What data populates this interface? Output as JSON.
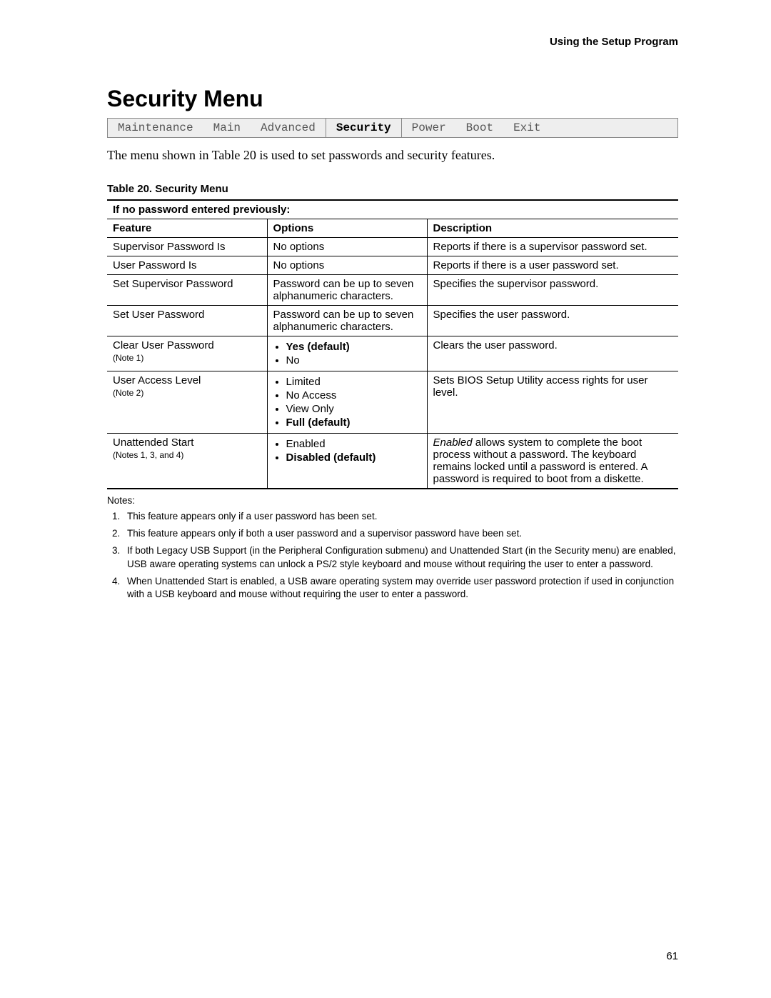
{
  "running_head": "Using the Setup Program",
  "section_title": "Security Menu",
  "bios_tabs": {
    "items": [
      "Maintenance",
      "Main",
      "Advanced",
      "Security",
      "Power",
      "Boot",
      "Exit"
    ],
    "active_index": 3
  },
  "intro_text": "The menu shown in Table 20 is used to set passwords and security features.",
  "table_caption": "Table 20.    Security Menu",
  "sub_header": "If no password entered previously:",
  "col_headers": {
    "feature": "Feature",
    "options": "Options",
    "description": "Description"
  },
  "rows": [
    {
      "feature": "Supervisor Password Is",
      "options_text": "No options",
      "description": "Reports if there is a supervisor password set."
    },
    {
      "feature": "User Password Is",
      "options_text": "No options",
      "description": "Reports if there is a user password set."
    },
    {
      "feature": "Set Supervisor Password",
      "options_text": "Password can be up to seven alphanumeric characters.",
      "description": "Specifies the supervisor password."
    },
    {
      "feature": "Set User Password",
      "options_text": "Password can be up to seven alphanumeric characters.",
      "description": "Specifies the user password."
    },
    {
      "feature": "Clear User Password",
      "feature_note": "(Note 1)",
      "options_list": [
        {
          "label": "Yes (default)",
          "default": true
        },
        {
          "label": "No",
          "default": false
        }
      ],
      "description": "Clears the user password."
    },
    {
      "feature": "User Access Level",
      "feature_note": "(Note 2)",
      "options_list": [
        {
          "label": "Limited",
          "default": false
        },
        {
          "label": "No Access",
          "default": false
        },
        {
          "label": "View Only",
          "default": false
        },
        {
          "label": "Full (default)",
          "default": true
        }
      ],
      "description": "Sets BIOS Setup Utility access rights for user level."
    },
    {
      "feature": "Unattended Start",
      "feature_note": "(Notes 1, 3, and 4)",
      "options_list": [
        {
          "label": "Enabled",
          "default": false
        },
        {
          "label": "Disabled (default)",
          "default": true
        }
      ],
      "description_lead_italic": "Enabled",
      "description_rest": " allows system to complete the boot process without a password.  The keyboard remains locked until a password is entered.  A password is required to boot from a diskette."
    }
  ],
  "notes_label": "Notes:",
  "notes": [
    "This feature appears only if a user password has been set.",
    "This feature appears only if both a user password and a supervisor password have been set.",
    "If both Legacy USB Support (in the Peripheral Configuration submenu) and Unattended Start (in the Security menu) are enabled, USB aware operating systems can unlock a PS/2 style keyboard and mouse without requiring the user to enter a password.",
    "When Unattended Start is enabled, a USB aware operating system may override user password protection if used in conjunction with a USB keyboard and mouse without requiring the user to enter a password."
  ],
  "page_number": "61"
}
